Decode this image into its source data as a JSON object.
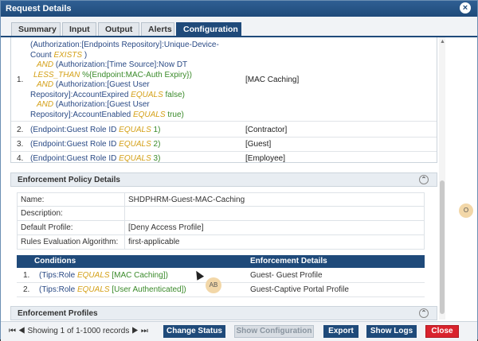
{
  "window": {
    "title": "Request Details"
  },
  "tabs": [
    {
      "label": "Summary"
    },
    {
      "label": "Input"
    },
    {
      "label": "Output"
    },
    {
      "label": "Alerts"
    },
    {
      "label": "Configuration"
    }
  ],
  "rules": [
    {
      "num": "1.",
      "lines": [
        [
          {
            "t": "(Authorization:[Endpoints Repository]:Unique-Device-",
            "c": "n"
          }
        ],
        [
          {
            "t": "Count ",
            "c": "n"
          },
          {
            "t": "EXISTS",
            "c": "k"
          },
          {
            "t": " )",
            "c": "n"
          }
        ],
        [
          {
            "t": "AND",
            "c": "k"
          },
          {
            "t": "   (Authorization:[Time Source]:Now DT",
            "c": "n"
          }
        ],
        [
          {
            "t": "LESS_THAN",
            "c": "k"
          },
          {
            "t": "  %{Endpoint:MAC-Auth Expiry})",
            "c": "v"
          }
        ],
        [
          {
            "t": "AND",
            "c": "k"
          },
          {
            "t": "   (Authorization:[Guest User",
            "c": "n"
          }
        ],
        [
          {
            "t": "Repository]:AccountExpired ",
            "c": "n"
          },
          {
            "t": "EQUALS",
            "c": "k"
          },
          {
            "t": "  false)",
            "c": "v"
          }
        ],
        [
          {
            "t": "AND",
            "c": "k"
          },
          {
            "t": "   (Authorization:[Guest User",
            "c": "n"
          }
        ],
        [
          {
            "t": "Repository]:AccountEnabled ",
            "c": "n"
          },
          {
            "t": "EQUALS",
            "c": "k"
          },
          {
            "t": "  true)",
            "c": "v"
          }
        ]
      ],
      "result": "[MAC Caching]"
    },
    {
      "num": "2.",
      "lines": [
        [
          {
            "t": "(Endpoint:Guest Role ID ",
            "c": "n"
          },
          {
            "t": "EQUALS",
            "c": "k"
          },
          {
            "t": "  1)",
            "c": "v"
          }
        ]
      ],
      "result": "[Contractor]"
    },
    {
      "num": "3.",
      "lines": [
        [
          {
            "t": "(Endpoint:Guest Role ID ",
            "c": "n"
          },
          {
            "t": "EQUALS",
            "c": "k"
          },
          {
            "t": "  2)",
            "c": "v"
          }
        ]
      ],
      "result": "[Guest]"
    },
    {
      "num": "4.",
      "lines": [
        [
          {
            "t": "(Endpoint:Guest Role ID ",
            "c": "n"
          },
          {
            "t": "EQUALS",
            "c": "k"
          },
          {
            "t": "  3)",
            "c": "v"
          }
        ]
      ],
      "result": "[Employee]"
    }
  ],
  "policy": {
    "header": "Enforcement Policy Details",
    "fields": [
      {
        "key": "Name:",
        "value": "SHDPHRM-Guest-MAC-Caching"
      },
      {
        "key": "Description:",
        "value": ""
      },
      {
        "key": "Default Profile:",
        "value": "[Deny Access Profile]"
      },
      {
        "key": "Rules Evaluation Algorithm:",
        "value": "first-applicable"
      }
    ]
  },
  "enforcement": {
    "col_conditions": "Conditions",
    "col_details": "Enforcement Details",
    "rows": [
      {
        "num": "1.",
        "pre": "(Tips:Role ",
        "op": "EQUALS",
        "val": "  [MAC Caching])",
        "details": "Guest- Guest Profile"
      },
      {
        "num": "2.",
        "pre": "(Tips:Role ",
        "op": "EQUALS",
        "val": "  [User Authenticated])",
        "details": "Guest-Captive Portal Profile"
      }
    ]
  },
  "profiles_header": "Enforcement Profiles",
  "footer": {
    "pager_text": "Showing 1 of 1-1000 records",
    "change_status": "Change Status",
    "show_configuration": "Show Configuration",
    "export": "Export",
    "show_logs": "Show Logs",
    "close": "Close"
  },
  "overlays": {
    "badge_ab": "AB",
    "badge_o": "O"
  },
  "colors": {
    "header": "#1f4a7a",
    "keyword": "#d4a017",
    "value": "#3a8a2a",
    "close": "#d9232d"
  }
}
